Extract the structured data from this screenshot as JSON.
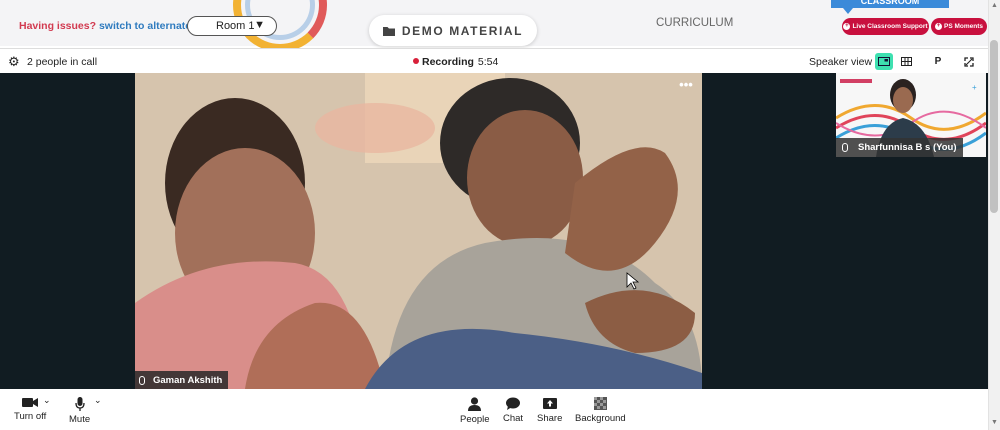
{
  "top": {
    "issues_text": "Having issues?",
    "alternate_link": "switch to alternate room",
    "room_value": "Room 1",
    "demo_label": "DEMO MATERIAL",
    "curriculum_label": "CURRICULUM",
    "classroom_tab": "CLASSROOM",
    "support_label": "Live Classroom Support",
    "moments_label": "PS Moments"
  },
  "call": {
    "people_count": "2 people in call",
    "recording_label": "Recording",
    "recording_time": "5:54",
    "speaker_view_label": "Speaker view",
    "p_button": "P"
  },
  "participants": {
    "main_name": "Gaman Akshith",
    "self_name": "Sharfunnisa B s (You)"
  },
  "controls": {
    "camera": "Turn off",
    "mic": "Mute",
    "people": "People",
    "chat": "Chat",
    "share": "Share",
    "background": "Background"
  },
  "colors": {
    "accent_red": "#c8103e",
    "link_blue": "#2f7bbf",
    "active_view": "#3ee0b0"
  },
  "icons": [
    "gear-icon",
    "folder-icon",
    "recording-dot-icon",
    "speaker-view-icon",
    "grid-view-icon",
    "expand-icon",
    "more-icon",
    "mic-icon",
    "camera-icon",
    "person-icon",
    "chat-icon",
    "share-icon",
    "background-icon"
  ]
}
